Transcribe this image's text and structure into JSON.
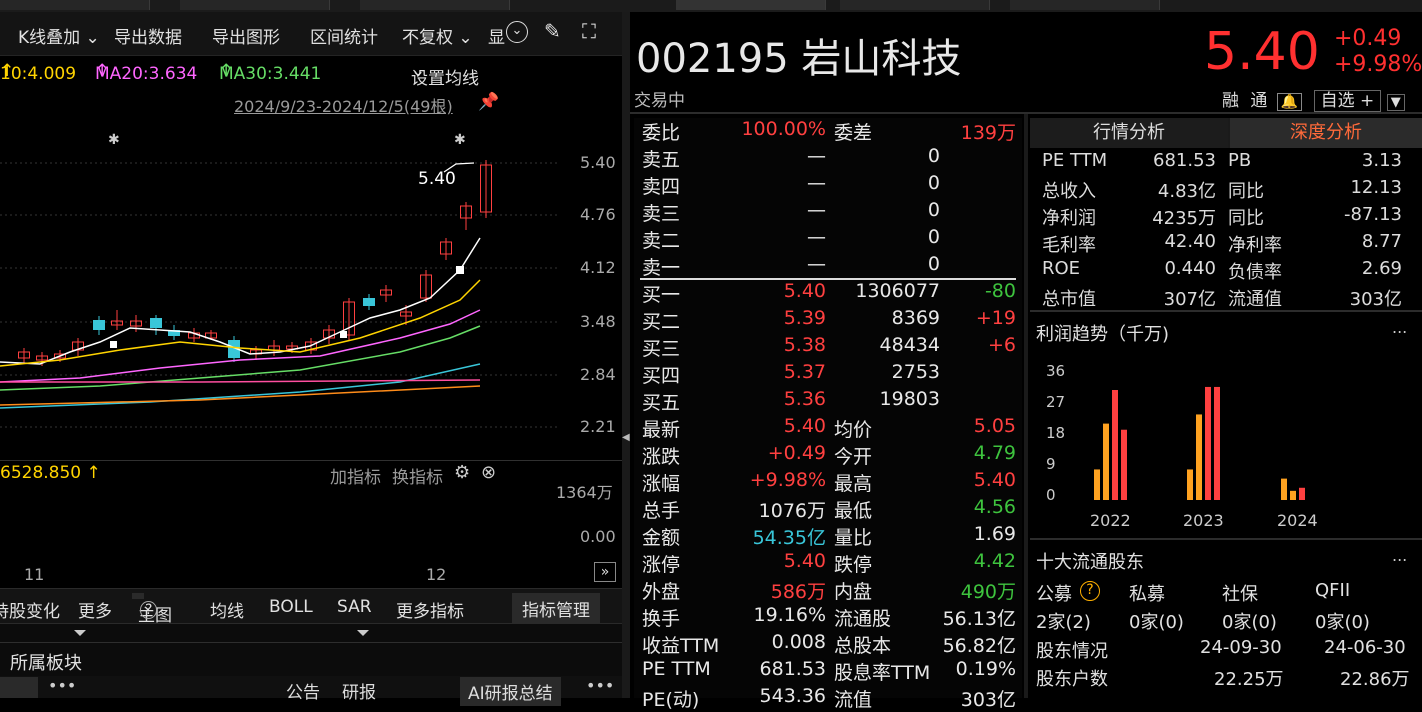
{
  "toolbar": {
    "kline_overlay": "K线叠加",
    "export_data": "导出数据",
    "export_chart": "导出图形",
    "range_stats": "区间统计",
    "fq": "不复权",
    "show": "显"
  },
  "ma_legend": {
    "ma10": "10:4.009",
    "ma20": "MA20:3.634",
    "ma30": "MA30:3.441",
    "set_ma": "设置均线"
  },
  "range": "2024/9/23-2024/12/5(49根)",
  "chart_data": {
    "type": "candlestick",
    "yticks": [
      "5.40",
      "4.76",
      "4.12",
      "3.48",
      "2.84",
      "2.21"
    ],
    "last_label": "5.40",
    "xticks": [
      "11",
      "12"
    ],
    "volume_ticks": [
      "1364万",
      "0.00"
    ],
    "volume_header": "6528.850",
    "colors": {
      "up": "#ff4040",
      "down": "#39c6d9",
      "ma5": "#ffffff",
      "ma10": "#ffd400",
      "ma20": "#ff66ff",
      "ma30": "#66dd66"
    }
  },
  "vol_actions": {
    "add": "加指标",
    "switch": "换指标"
  },
  "bottombar": {
    "a": "持股变化",
    "b": "更多",
    "c": "主图",
    "d": "均线",
    "e": "BOLL",
    "f": "SAR",
    "g": "更多指标",
    "h": "指标管理"
  },
  "sector": {
    "title": "所属板块",
    "tab1": "公告",
    "tab2": "研报",
    "ai": "AI研报总结"
  },
  "stock": {
    "code_name": "002195 岩山科技",
    "price": "5.40",
    "change": "+0.49",
    "change_pct": "+9.98%",
    "status": "交易中",
    "rz": "融",
    "tong": "通",
    "zixuan": "自选 +"
  },
  "quote": {
    "wb_label": "委比",
    "wb_val": "100.00%",
    "wc_label": "委差",
    "wc_val": "139万",
    "sells": [
      {
        "l": "卖五",
        "p": "—",
        "v": "0"
      },
      {
        "l": "卖四",
        "p": "—",
        "v": "0"
      },
      {
        "l": "卖三",
        "p": "—",
        "v": "0"
      },
      {
        "l": "卖二",
        "p": "—",
        "v": "0"
      },
      {
        "l": "卖一",
        "p": "—",
        "v": "0"
      }
    ],
    "buys": [
      {
        "l": "买一",
        "p": "5.40",
        "v": "1306077",
        "c": "-80"
      },
      {
        "l": "买二",
        "p": "5.39",
        "v": "8369",
        "c": "+19"
      },
      {
        "l": "买三",
        "p": "5.38",
        "v": "48434",
        "c": "+6"
      },
      {
        "l": "买四",
        "p": "5.37",
        "v": "2753",
        "c": ""
      },
      {
        "l": "买五",
        "p": "5.36",
        "v": "19803",
        "c": ""
      }
    ],
    "stats": [
      {
        "l1": "最新",
        "v1": "5.40",
        "l2": "均价",
        "v2": "5.05"
      },
      {
        "l1": "涨跌",
        "v1": "+0.49",
        "l2": "今开",
        "v2": "4.79"
      },
      {
        "l1": "涨幅",
        "v1": "+9.98%",
        "l2": "最高",
        "v2": "5.40"
      },
      {
        "l1": "总手",
        "v1": "1076万",
        "l2": "最低",
        "v2": "4.56"
      },
      {
        "l1": "金额",
        "v1": "54.35亿",
        "l2": "量比",
        "v2": "1.69"
      },
      {
        "l1": "涨停",
        "v1": "5.40",
        "l2": "跌停",
        "v2": "4.42"
      },
      {
        "l1": "外盘",
        "v1": "586万",
        "l2": "内盘",
        "v2": "490万"
      },
      {
        "l1": "换手",
        "v1": "19.16%",
        "l2": "流通股",
        "v2": "56.13亿"
      },
      {
        "l1": "收益TTM",
        "v1": "0.008",
        "l2": "总股本",
        "v2": "56.82亿"
      },
      {
        "l1": "PE TTM",
        "v1": "681.53",
        "l2": "股息率TTM",
        "v2": "0.19%"
      },
      {
        "l1": "PE(动)",
        "v1": "543.36",
        "l2": "流值",
        "v2": "303亿"
      }
    ]
  },
  "fin": {
    "tab1": "行情分析",
    "tab2": "深度分析",
    "rows": [
      {
        "l1": "PE TTM",
        "v1": "681.53",
        "l2": "PB",
        "v2": "3.13"
      },
      {
        "l1": "总收入",
        "v1": "4.83亿",
        "l2": "同比",
        "v2": "12.13"
      },
      {
        "l1": "净利润",
        "v1": "4235万",
        "l2": "同比",
        "v2": "-87.13"
      },
      {
        "l1": "毛利率",
        "v1": "42.40",
        "l2": "净利率",
        "v2": "8.77"
      },
      {
        "l1": "ROE",
        "v1": "0.440",
        "l2": "负债率",
        "v2": "2.69"
      },
      {
        "l1": "总市值",
        "v1": "307亿",
        "l2": "流通值",
        "v2": "303亿"
      }
    ]
  },
  "profit": {
    "title": "利润趋势（千万)",
    "more": "...",
    "yticks": [
      "36",
      "27",
      "18",
      "9",
      "0"
    ],
    "years": [
      "2022",
      "2023",
      "2024"
    ],
    "bars": [
      [
        10,
        25,
        36,
        23
      ],
      [
        10,
        28,
        37,
        37
      ],
      [
        7,
        3,
        4
      ]
    ]
  },
  "holders": {
    "title": "十大流通股东",
    "more": "...",
    "cats": [
      "公募",
      "私募",
      "社保",
      "QFII"
    ],
    "vals": [
      "2家(2)",
      "0家(0)",
      "0家(0)",
      "0家(0)"
    ],
    "r1": [
      "股东情况",
      "24-09-30",
      "24-06-30"
    ],
    "r2": [
      "股东户数",
      "22.25万",
      "22.86万"
    ]
  }
}
